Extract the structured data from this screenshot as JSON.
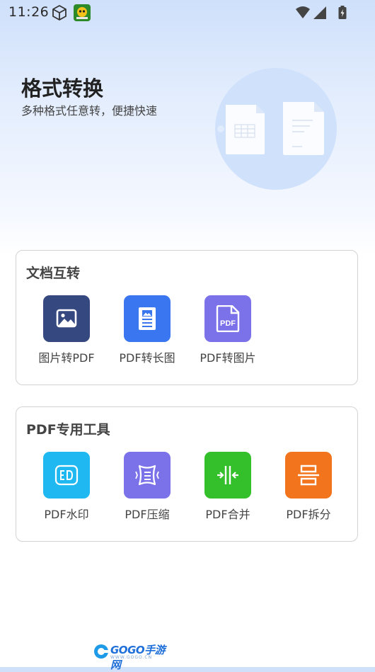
{
  "status_bar": {
    "time": "11:26"
  },
  "header": {
    "title": "格式转换",
    "subtitle": "多种格式任意转，便捷快速"
  },
  "sections": [
    {
      "title": "文档互转",
      "tools": [
        {
          "label": "图片转PDF",
          "icon": "image-icon",
          "color": "#35487f"
        },
        {
          "label": "PDF转长图",
          "icon": "long-image-icon",
          "color": "#3a76f0"
        },
        {
          "label": "PDF转图片",
          "icon": "pdf-file-icon",
          "color": "#7b72ea"
        }
      ]
    },
    {
      "title": "PDF专用工具",
      "tools": [
        {
          "label": "PDF水印",
          "icon": "watermark-icon",
          "color": "#1fb8f0"
        },
        {
          "label": "PDF压缩",
          "icon": "compress-icon",
          "color": "#7b72ea"
        },
        {
          "label": "PDF合并",
          "icon": "merge-icon",
          "color": "#34c02a"
        },
        {
          "label": "PDF拆分",
          "icon": "split-icon",
          "color": "#f2741c"
        }
      ]
    }
  ],
  "footer": {
    "logo_text": "GOGO手游网",
    "logo_sub": "WWW.GOGO.CN"
  }
}
